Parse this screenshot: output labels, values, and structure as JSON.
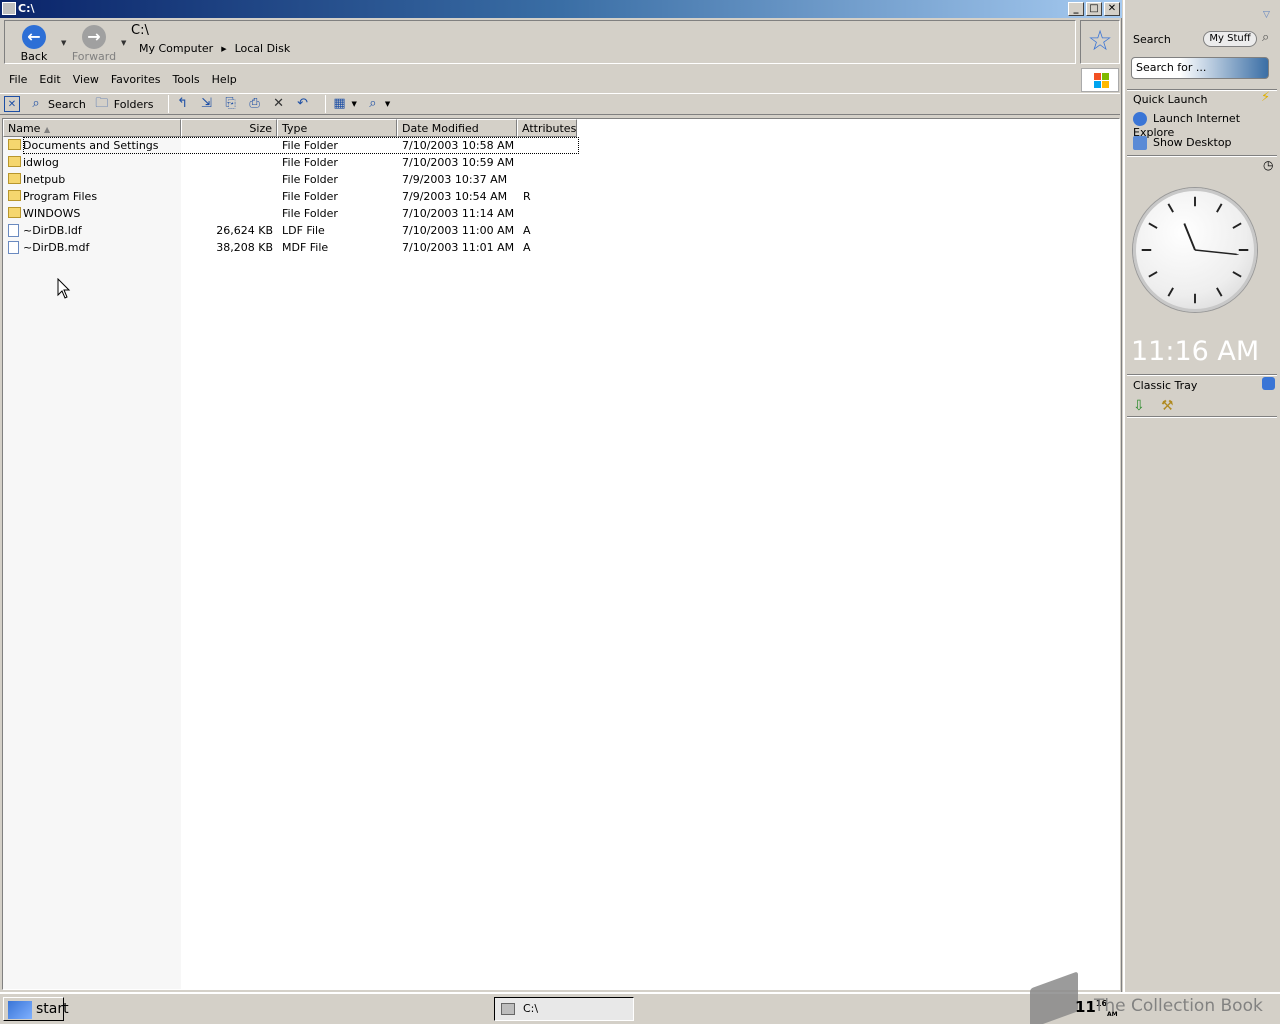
{
  "window": {
    "title": "C:\\",
    "controls": [
      "_",
      "□",
      "✕"
    ]
  },
  "nav": {
    "back_label": "Back",
    "forward_label": "Forward",
    "path_title": "C:\\",
    "crumbs": [
      "My Computer",
      "Local Disk"
    ]
  },
  "menubar": [
    "File",
    "Edit",
    "View",
    "Favorites",
    "Tools",
    "Help"
  ],
  "toolbar": {
    "search_label": "Search",
    "folders_label": "Folders"
  },
  "columns": [
    "Name",
    "Size",
    "Type",
    "Date Modified",
    "Attributes"
  ],
  "files": [
    {
      "name": "Documents and Settings",
      "size": "",
      "type": "File Folder",
      "date": "7/10/2003 10:58 AM",
      "attr": "",
      "kind": "folder"
    },
    {
      "name": "idwlog",
      "size": "",
      "type": "File Folder",
      "date": "7/10/2003 10:59 AM",
      "attr": "",
      "kind": "folder"
    },
    {
      "name": "Inetpub",
      "size": "",
      "type": "File Folder",
      "date": "7/9/2003 10:37 AM",
      "attr": "",
      "kind": "folder"
    },
    {
      "name": "Program Files",
      "size": "",
      "type": "File Folder",
      "date": "7/9/2003 10:54 AM",
      "attr": "R",
      "kind": "folder"
    },
    {
      "name": "WINDOWS",
      "size": "",
      "type": "File Folder",
      "date": "7/10/2003 11:14 AM",
      "attr": "",
      "kind": "folder"
    },
    {
      "name": "~DirDB.ldf",
      "size": "26,624 KB",
      "type": "LDF File",
      "date": "7/10/2003 11:00 AM",
      "attr": "A",
      "kind": "file"
    },
    {
      "name": "~DirDB.mdf",
      "size": "38,208 KB",
      "type": "MDF File",
      "date": "7/10/2003 11:01 AM",
      "attr": "A",
      "kind": "file"
    }
  ],
  "sidebar": {
    "search_title": "Search",
    "mystuff_label": "My Stuff",
    "search_placeholder": "Search for ...",
    "quicklaunch_title": "Quick Launch",
    "quicklaunch_items": [
      "Launch Internet Explore",
      "Show Desktop"
    ],
    "time": "11:16 AM",
    "classic_tray_title": "Classic Tray"
  },
  "taskbar": {
    "start_label": "start",
    "task_label": "C:\\",
    "tray_hour": "11",
    "tray_minute": "16",
    "tray_ampm": "AM"
  },
  "watermark": "The Collection Book"
}
